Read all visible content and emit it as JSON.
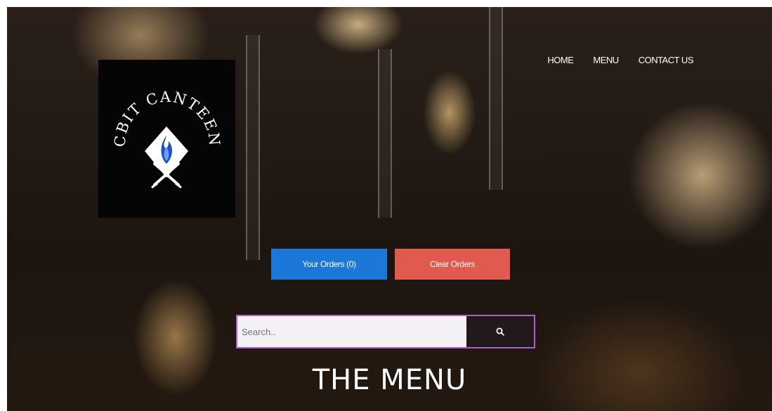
{
  "nav": {
    "items": [
      {
        "label": "HOME"
      },
      {
        "label": "MENU"
      },
      {
        "label": "CONTACT US"
      }
    ]
  },
  "logo": {
    "text": "CBIT CANTEEN",
    "icon": "flame-knife-fork-icon"
  },
  "actions": {
    "orders_label": "Your Orders (0)",
    "clear_label": "Clear Orders",
    "orders_color": "#1b77d8",
    "clear_color": "#e05a50"
  },
  "search": {
    "placeholder": "Search..",
    "value": "",
    "icon": "search-icon"
  },
  "section": {
    "title": "THE MENU"
  }
}
